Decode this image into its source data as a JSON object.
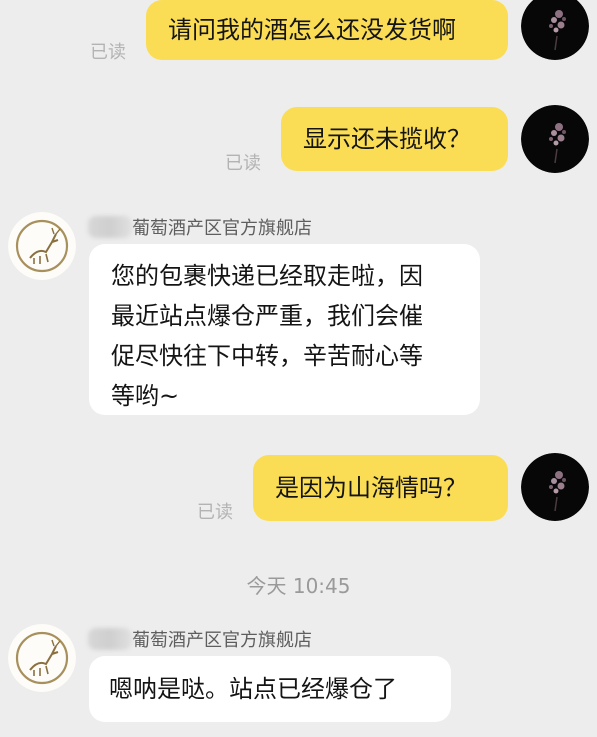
{
  "messages": [
    {
      "side": "out",
      "text": "请问我的酒怎么还没发货啊",
      "status": "已读"
    },
    {
      "side": "out",
      "text": "显示还未揽收？",
      "status": "已读"
    },
    {
      "side": "in",
      "sender": "葡萄酒产区官方旗舰店",
      "lines": [
        "您的包裹快递已经取走啦，因",
        "最近站点爆仓严重，我们会催",
        "促尽快往下中转，辛苦耐心等",
        "等哟~"
      ]
    },
    {
      "side": "out",
      "text": "是因为山海情吗？",
      "status": "已读"
    },
    {
      "side": "time",
      "text": "今天  10:45"
    },
    {
      "side": "in",
      "sender": "葡萄酒产区官方旗舰店",
      "text": "嗯呐是哒。站点已经爆仓了"
    }
  ],
  "colors": {
    "background": "#ededed",
    "outgoing_bubble": "#fadd55",
    "incoming_bubble": "#ffffff"
  },
  "icons": {
    "user_avatar": "dark-floral-avatar",
    "shop_avatar": "deer-logo-avatar"
  }
}
